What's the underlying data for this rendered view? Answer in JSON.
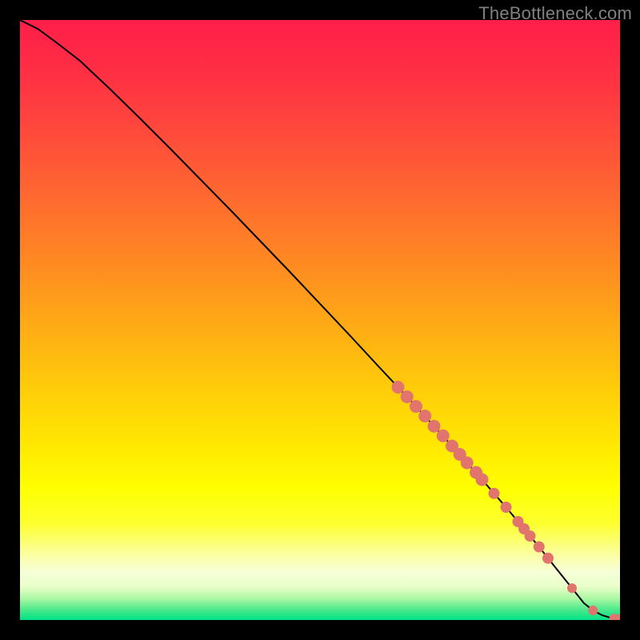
{
  "watermark": "TheBottleneck.com",
  "gradient_stops": [
    {
      "offset": 0.0,
      "color": "#ff1f49"
    },
    {
      "offset": 0.07,
      "color": "#ff2b45"
    },
    {
      "offset": 0.15,
      "color": "#ff3f3f"
    },
    {
      "offset": 0.23,
      "color": "#ff5637"
    },
    {
      "offset": 0.31,
      "color": "#ff6e2e"
    },
    {
      "offset": 0.39,
      "color": "#ff8524"
    },
    {
      "offset": 0.47,
      "color": "#ff9e1a"
    },
    {
      "offset": 0.55,
      "color": "#ffb810"
    },
    {
      "offset": 0.63,
      "color": "#ffd108"
    },
    {
      "offset": 0.71,
      "color": "#ffe802"
    },
    {
      "offset": 0.78,
      "color": "#ffff00"
    },
    {
      "offset": 0.84,
      "color": "#fdff30"
    },
    {
      "offset": 0.89,
      "color": "#fbffa0"
    },
    {
      "offset": 0.92,
      "color": "#f7ffd8"
    },
    {
      "offset": 0.945,
      "color": "#e8ffc8"
    },
    {
      "offset": 0.965,
      "color": "#a8f7a2"
    },
    {
      "offset": 0.985,
      "color": "#40e889"
    },
    {
      "offset": 1.0,
      "color": "#00e288"
    }
  ],
  "marker_color": "#e2746e",
  "line_color": "#000000",
  "chart_data": {
    "type": "line",
    "title": "",
    "xlabel": "",
    "ylabel": "",
    "xlim": [
      0,
      100
    ],
    "ylim": [
      0,
      100
    ],
    "series": [
      {
        "name": "curve",
        "x": [
          0,
          3,
          6,
          10,
          15,
          20,
          25,
          30,
          35,
          40,
          45,
          50,
          55,
          60,
          63,
          66,
          69,
          72,
          74.5,
          77,
          79,
          81,
          83,
          85,
          86.5,
          88,
          90,
          92,
          94,
          95.5,
          97,
          98.5,
          100
        ],
        "y": [
          100,
          98.5,
          96.3,
          93.2,
          88.5,
          83.6,
          78.6,
          73.5,
          68.4,
          63.2,
          58.0,
          52.7,
          47.4,
          42.0,
          38.8,
          35.6,
          32.3,
          29.0,
          26.2,
          23.4,
          21.1,
          18.8,
          16.4,
          14.0,
          12.2,
          10.3,
          7.8,
          5.3,
          2.8,
          1.6,
          0.8,
          0.35,
          0.2
        ]
      }
    ],
    "markers": {
      "name": "points",
      "x": [
        63,
        64.5,
        66,
        67.5,
        69,
        70.5,
        72,
        73.3,
        74.5,
        76,
        77,
        79,
        81,
        83,
        84,
        85,
        86.5,
        88,
        92,
        95.5,
        99,
        100
      ],
      "y": [
        38.8,
        37.2,
        35.6,
        34.0,
        32.3,
        30.7,
        29.0,
        27.6,
        26.2,
        24.6,
        23.4,
        21.1,
        18.8,
        16.4,
        15.2,
        14.0,
        12.2,
        10.3,
        5.3,
        1.6,
        0.25,
        0.2
      ],
      "r": [
        8,
        8,
        8,
        8,
        8,
        8,
        8,
        8,
        8,
        8,
        8,
        7,
        7,
        7,
        7,
        7,
        7,
        7,
        6,
        6,
        6,
        6
      ]
    }
  }
}
